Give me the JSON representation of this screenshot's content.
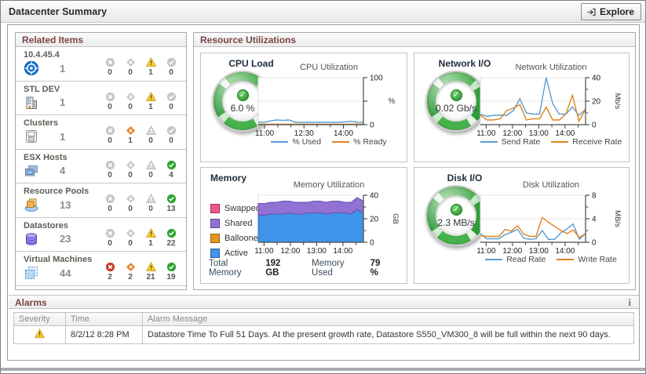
{
  "header": {
    "title": "Datacenter Summary",
    "explore_label": "Explore",
    "explore_icon": "arrow-into-box-icon"
  },
  "related_items": {
    "title": "Related Items",
    "severity_icons": [
      "fatal-icon",
      "critical-icon",
      "warning-icon",
      "normal-icon"
    ],
    "items": [
      {
        "name": "10.4.45.4",
        "icon": "vcenter-icon",
        "count": "1",
        "severity_counts": [
          0,
          0,
          1,
          0
        ]
      },
      {
        "name": "STL DEV",
        "icon": "datacenter-icon",
        "count": "1",
        "severity_counts": [
          0,
          0,
          1,
          0
        ]
      },
      {
        "name": "Clusters",
        "icon": "cluster-icon",
        "count": "1",
        "severity_counts": [
          0,
          1,
          0,
          0
        ]
      },
      {
        "name": "ESX Hosts",
        "icon": "esx-host-icon",
        "count": "4",
        "severity_counts": [
          0,
          0,
          0,
          4
        ]
      },
      {
        "name": "Resource Pools",
        "icon": "resource-pool-icon",
        "count": "13",
        "severity_counts": [
          0,
          0,
          0,
          13
        ]
      },
      {
        "name": "Datastores",
        "icon": "datastore-icon",
        "count": "23",
        "severity_counts": [
          0,
          0,
          1,
          22
        ]
      },
      {
        "name": "Virtual Machines",
        "icon": "virtual-machine-icon",
        "count": "44",
        "severity_counts": [
          2,
          2,
          21,
          19
        ]
      }
    ]
  },
  "resource_utilizations": {
    "title": "Resource Utilizations",
    "quadrants": [
      {
        "id": "cpu",
        "title": "CPU Load",
        "gauge": {
          "value": "6.0 %",
          "status_icon": "check-badge-icon"
        },
        "chart": 0
      },
      {
        "id": "network",
        "title": "Network I/O",
        "gauge": {
          "value": "0.02 Gb/s",
          "status_icon": "check-badge-icon"
        },
        "chart": 1
      },
      {
        "id": "memory",
        "title": "Memory",
        "legend": [
          {
            "label": "Swapped",
            "color": "#f0538e"
          },
          {
            "label": "Shared",
            "color": "#9271d4"
          },
          {
            "label": "Ballooned",
            "color": "#e8941e"
          },
          {
            "label": "Active",
            "color": "#3f93e8"
          }
        ],
        "footer": {
          "total_label": "Total Memory",
          "total_value": "192 GB",
          "used_label": "Memory Used",
          "used_value": "79 %"
        },
        "chart": 2
      },
      {
        "id": "disk",
        "title": "Disk I/O",
        "gauge": {
          "value": "2.3 MB/s",
          "status_icon": "check-badge-icon"
        },
        "chart": 3
      }
    ]
  },
  "chart_data": [
    {
      "id": "cpu",
      "type": "line",
      "title": "CPU Utilization",
      "ylim": [
        0,
        100
      ],
      "y_unit": "%",
      "y_unit_rotated": false,
      "grid": true,
      "legend_position": "bottom",
      "y_ticks": [
        {
          "v": 0,
          "label": "0"
        },
        {
          "v": 50,
          "label": ""
        },
        {
          "v": 100,
          "label": "100"
        }
      ],
      "y_minor": [],
      "x_ticks": [
        {
          "f": 0.06,
          "label": "11:00"
        },
        {
          "f": 0.185
        },
        {
          "f": 0.31
        },
        {
          "f": 0.435,
          "label": "12:30"
        },
        {
          "f": 0.56
        },
        {
          "f": 0.685
        },
        {
          "f": 0.81,
          "label": "14:00"
        },
        {
          "f": 0.935
        }
      ],
      "series": [
        {
          "name": "% Used",
          "color": "#5b9bd0",
          "values": [
            5,
            5,
            8,
            10,
            9,
            10,
            5,
            5,
            5,
            5,
            5,
            5,
            5,
            5,
            6,
            7,
            5,
            5
          ]
        },
        {
          "name": "% Ready",
          "color": "#e0821e",
          "values": [
            1,
            1,
            1,
            1,
            1,
            1,
            1,
            1,
            1,
            1,
            1,
            1,
            1,
            1,
            1,
            1,
            1,
            1
          ]
        }
      ]
    },
    {
      "id": "network",
      "type": "line",
      "title": "Network Utilization",
      "ylim": [
        0,
        40
      ],
      "y_unit": "Mb/s",
      "y_unit_rotated": true,
      "grid": true,
      "legend_position": "bottom",
      "y_ticks": [
        {
          "v": 0,
          "label": "0"
        },
        {
          "v": 20,
          "label": "20"
        },
        {
          "v": 40,
          "label": "40"
        }
      ],
      "y_minor": [
        10,
        30
      ],
      "x_ticks": [
        {
          "f": 0.055,
          "label": "11:00"
        },
        {
          "f": 0.18
        },
        {
          "f": 0.305,
          "label": "12:00"
        },
        {
          "f": 0.43
        },
        {
          "f": 0.555,
          "label": "13:00"
        },
        {
          "f": 0.68
        },
        {
          "f": 0.805,
          "label": "14:00"
        },
        {
          "f": 0.93
        }
      ],
      "series": [
        {
          "name": "Send Rate",
          "color": "#5b9bd0",
          "values": [
            9,
            7,
            8,
            8,
            8,
            12,
            22,
            10,
            9,
            9,
            40,
            18,
            9,
            9,
            15,
            8,
            13
          ]
        },
        {
          "name": "Receive Rate",
          "color": "#e0821e",
          "values": [
            8,
            4,
            4,
            5,
            12,
            14,
            17,
            4,
            5,
            5,
            15,
            4,
            4,
            9,
            25,
            3,
            13
          ]
        }
      ]
    },
    {
      "id": "memory",
      "type": "area",
      "title": "Memory Utilization",
      "ylim": [
        0,
        40
      ],
      "y_unit": "GB",
      "y_unit_rotated": true,
      "grid": true,
      "legend_position": "none",
      "y_ticks": [
        {
          "v": 0,
          "label": "0"
        },
        {
          "v": 20,
          "label": "20"
        },
        {
          "v": 40,
          "label": "40"
        }
      ],
      "y_minor": [
        10,
        30
      ],
      "x_ticks": [
        {
          "f": 0.055,
          "label": "11:00"
        },
        {
          "f": 0.18
        },
        {
          "f": 0.305,
          "label": "12:00"
        },
        {
          "f": 0.43
        },
        {
          "f": 0.555,
          "label": "13:00"
        },
        {
          "f": 0.68
        },
        {
          "f": 0.805,
          "label": "14:00"
        },
        {
          "f": 0.93
        }
      ],
      "series": [
        {
          "name": "Active",
          "color": "#3f93e8",
          "stroke": "#2a6fb8",
          "values": [
            23,
            23,
            24,
            24,
            24,
            25,
            24,
            24,
            25,
            25,
            25,
            24,
            25,
            25,
            25,
            24,
            28,
            24
          ]
        },
        {
          "name": "Shared",
          "color": "#9271d4",
          "stroke": "#6a4fb0",
          "values": [
            10,
            10,
            10,
            10,
            11,
            10,
            10,
            10,
            9,
            10,
            10,
            10,
            10,
            10,
            9,
            10,
            10,
            11
          ]
        }
      ]
    },
    {
      "id": "disk",
      "type": "line",
      "title": "Disk Utilization",
      "ylim": [
        0,
        8
      ],
      "y_unit": "MB/s",
      "y_unit_rotated": true,
      "grid": true,
      "legend_position": "bottom",
      "y_ticks": [
        {
          "v": 0,
          "label": "0"
        },
        {
          "v": 4,
          "label": "4"
        },
        {
          "v": 8,
          "label": "8"
        }
      ],
      "y_minor": [
        2,
        6
      ],
      "x_ticks": [
        {
          "f": 0.055,
          "label": "11:00"
        },
        {
          "f": 0.18
        },
        {
          "f": 0.305,
          "label": "12:00"
        },
        {
          "f": 0.43
        },
        {
          "f": 0.555,
          "label": "13:00"
        },
        {
          "f": 0.68
        },
        {
          "f": 0.805,
          "label": "14:00"
        },
        {
          "f": 0.93
        }
      ],
      "series": [
        {
          "name": "Read Rate",
          "color": "#5b9bd0",
          "values": [
            1.5,
            0.6,
            0.6,
            0.6,
            1.3,
            1.7,
            2.2,
            0.7,
            0.5,
            0.6,
            2.0,
            0.5,
            0.5,
            1.6,
            2.3,
            3.1,
            0.5,
            1.5
          ]
        },
        {
          "name": "Write Rate",
          "color": "#e0821e",
          "values": [
            1.1,
            1.0,
            1.0,
            1.0,
            2.2,
            1.9,
            2.8,
            1.4,
            1.0,
            1.0,
            4.2,
            3.4,
            2.7,
            2.0,
            1.5,
            2.1,
            0.8,
            1.5
          ]
        }
      ]
    }
  ],
  "alarms": {
    "title": "Alarms",
    "info_icon": "info-icon",
    "columns": [
      "Severity",
      "Time",
      "Alarm Message"
    ],
    "rows": [
      {
        "severity_icon": "warning-icon",
        "time": "8/2/12 8:28 PM",
        "message": "Datastore Time To Full 51 Days. At the present growth rate, Datastore S550_VM300_8 will be full within the next 90 days."
      }
    ]
  }
}
